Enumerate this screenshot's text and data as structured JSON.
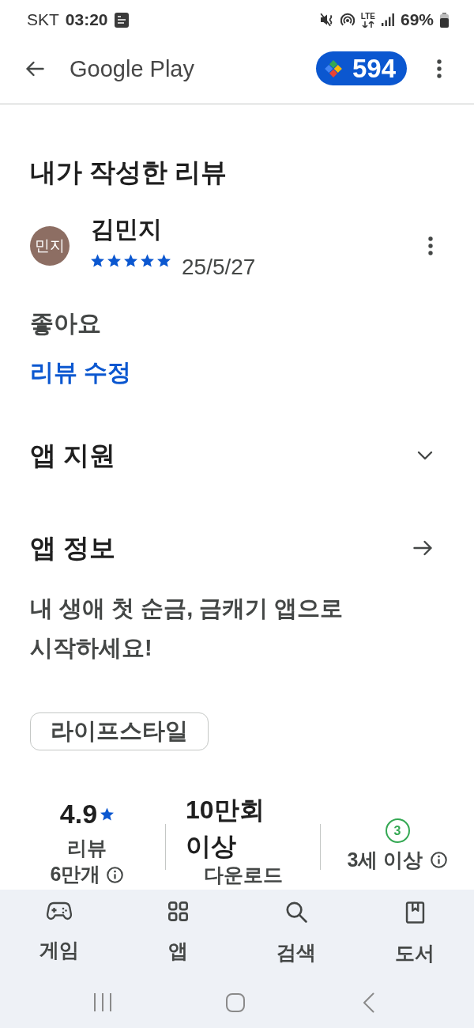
{
  "status_bar": {
    "carrier": "SKT",
    "time": "03:20",
    "network": "LTE",
    "battery": "69%"
  },
  "app_bar": {
    "title": "Google Play",
    "points": "594"
  },
  "my_review": {
    "heading": "내가 작성한 리뷰",
    "avatar": "민지",
    "author": "김민지",
    "stars": 5,
    "date": "25/5/27",
    "text": "좋아요",
    "edit_link": "리뷰 수정"
  },
  "sections": [
    {
      "kind": "expand",
      "title": "앱 지원",
      "expanded": false
    },
    {
      "kind": "link",
      "title": "앱 정보"
    }
  ],
  "app_info": {
    "description": "내 생애 첫 순금, 금캐기 앱으로 시작하세요!",
    "category": "라이프스타일"
  },
  "stats": [
    {
      "kind": "rating",
      "value": "4.9",
      "caption": "리뷰 6만개"
    },
    {
      "kind": "downloads",
      "value": "10만회 이상",
      "caption": "다운로드"
    },
    {
      "kind": "age",
      "badge": "3",
      "caption": "3세 이상"
    }
  ],
  "bottom_nav": [
    {
      "label": "게임",
      "selected": false
    },
    {
      "label": "앱",
      "selected": false
    },
    {
      "label": "검색",
      "selected": false
    },
    {
      "label": "도서",
      "selected": false
    }
  ]
}
